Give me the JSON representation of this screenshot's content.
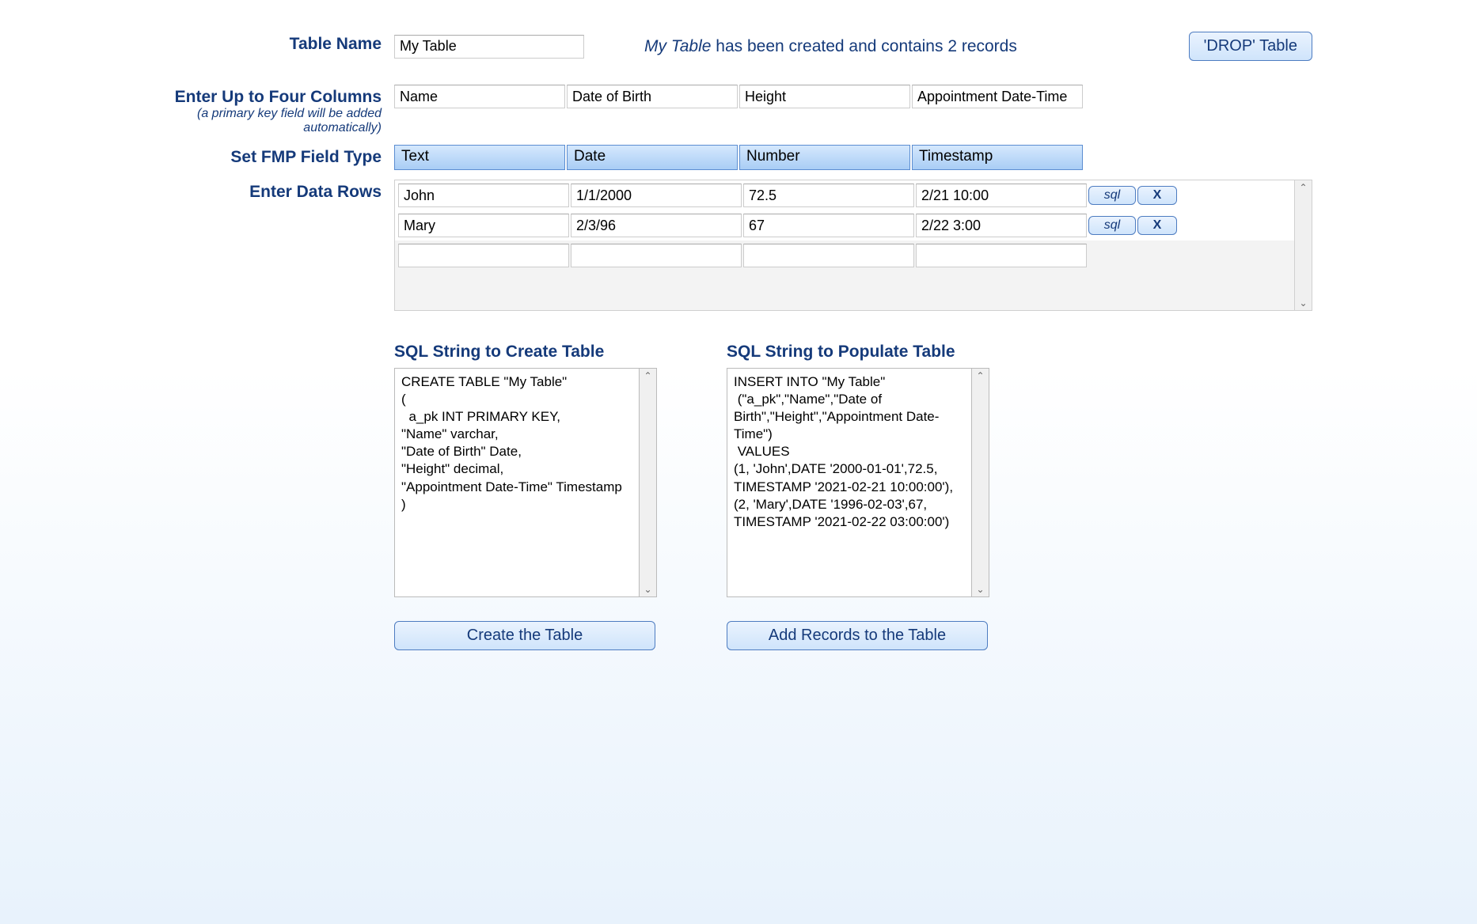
{
  "labels": {
    "table_name": "Table Name",
    "columns": "Enter Up to Four Columns",
    "columns_sub": "(a primary key field will be added automatically)",
    "field_type": "Set  FMP Field Type",
    "data_rows": "Enter Data Rows"
  },
  "table_name_value": "My Table",
  "status": {
    "prefix_name": "My Table",
    "rest": " has been created and contains 2 records"
  },
  "drop_button": "'DROP' Table",
  "columns": [
    "Name",
    "Date of Birth",
    "Height",
    "Appointment Date-Time"
  ],
  "types": [
    "Text",
    "Date",
    "Number",
    "Timestamp"
  ],
  "rows": [
    {
      "c": [
        "John",
        "1/1/2000",
        "72.5",
        "2/21 10:00"
      ]
    },
    {
      "c": [
        "Mary",
        "2/3/96",
        "67",
        "2/22 3:00"
      ]
    },
    {
      "c": [
        "",
        "",
        "",
        ""
      ]
    }
  ],
  "row_buttons": {
    "sql": "sql",
    "x": "X"
  },
  "sql_create": {
    "heading": "SQL String to Create Table",
    "text": "CREATE TABLE \"My Table\"\n(\n  a_pk INT PRIMARY KEY,\n\"Name\" varchar,\n\"Date of Birth\" Date,\n\"Height\" decimal,\n\"Appointment Date-Time\" Timestamp\n)",
    "button": "Create the Table"
  },
  "sql_populate": {
    "heading": "SQL String to Populate Table",
    "text": "INSERT INTO \"My Table\"\n (\"a_pk\",\"Name\",\"Date of Birth\",\"Height\",\"Appointment Date-Time\")\n VALUES\n(1, 'John',DATE '2000-01-01',72.5, TIMESTAMP '2021-02-21 10:00:00'),\n(2, 'Mary',DATE '1996-02-03',67, TIMESTAMP '2021-02-22 03:00:00')",
    "button": "Add Records to the Table"
  }
}
